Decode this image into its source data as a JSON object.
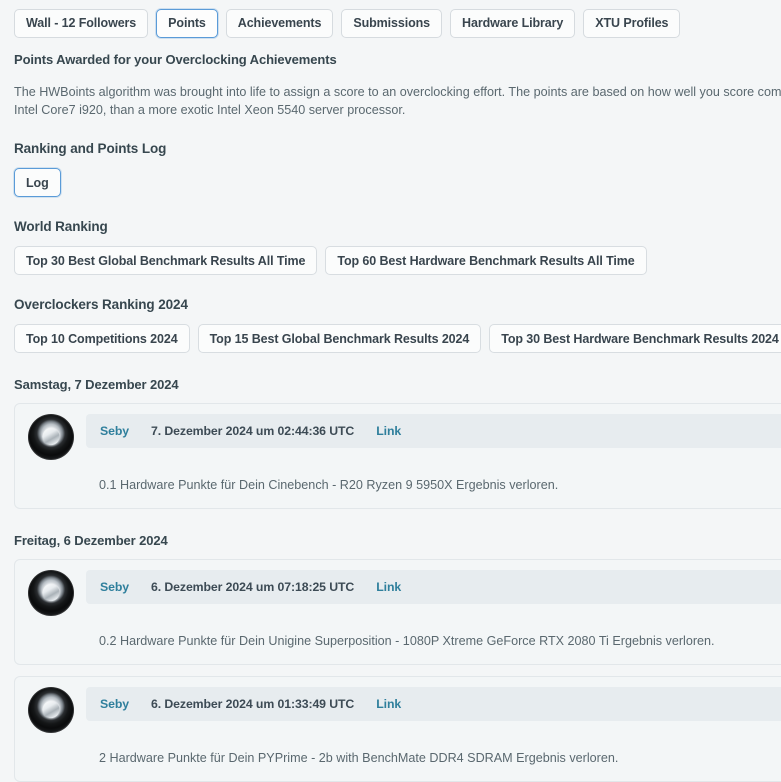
{
  "tabs": [
    {
      "label": "Wall - 12 Followers",
      "active": false
    },
    {
      "label": "Points",
      "active": true
    },
    {
      "label": "Achievements",
      "active": false
    },
    {
      "label": "Submissions",
      "active": false
    },
    {
      "label": "Hardware Library",
      "active": false
    },
    {
      "label": "XTU Profiles",
      "active": false
    }
  ],
  "page": {
    "heading": "Points Awarded for your Overclocking Achievements",
    "intro": "The HWBoints algorithm was brought into life to assign a score to an overclocking effort. The points are based on how well you score compared to others. You will get more points for being first with a popular Intel Core7 i920, than a more exotic Intel Xeon 5540 server processor."
  },
  "ranking_log": {
    "title": "Ranking and Points Log",
    "buttons": [
      {
        "label": "Log",
        "focused": true
      }
    ]
  },
  "world_ranking": {
    "title": "World Ranking",
    "buttons": [
      {
        "label": "Top 30 Best Global Benchmark Results All Time",
        "focused": false
      },
      {
        "label": "Top 60 Best Hardware Benchmark Results All Time",
        "focused": false
      }
    ]
  },
  "overclockers_ranking": {
    "title": "Overclockers Ranking 2024",
    "buttons": [
      {
        "label": "Top 10 Competitions 2024",
        "focused": false
      },
      {
        "label": "Top 15 Best Global Benchmark Results 2024",
        "focused": false
      },
      {
        "label": "Top 30 Best Hardware Benchmark Results 2024",
        "focused": false
      }
    ]
  },
  "log_days": [
    {
      "date_heading": "Samstag, 7 Dezember 2024",
      "entries": [
        {
          "author": "Seby",
          "timestamp": "7. Dezember 2024 um 02:44:36 UTC",
          "link_label": "Link",
          "message": "0.1 Hardware Punkte für Dein Cinebench - R20 Ryzen 9 5950X Ergebnis verloren.",
          "avatar_icon": "user-avatar-icon"
        }
      ]
    },
    {
      "date_heading": "Freitag, 6 Dezember 2024",
      "entries": [
        {
          "author": "Seby",
          "timestamp": "6. Dezember 2024 um 07:18:25 UTC",
          "link_label": "Link",
          "message": "0.2 Hardware Punkte für Dein Unigine Superposition - 1080P Xtreme GeForce RTX 2080 Ti Ergebnis verloren.",
          "avatar_icon": "user-avatar-icon"
        },
        {
          "author": "Seby",
          "timestamp": "6. Dezember 2024 um 01:33:49 UTC",
          "link_label": "Link",
          "message": "2 Hardware Punkte für Dein PYPrime - 2b with BenchMate DDR4 SDRAM Ergebnis verloren.",
          "avatar_icon": "user-avatar-icon"
        }
      ]
    }
  ],
  "colors": {
    "page_background": "#f4f6f7",
    "heading_text": "#37474f",
    "body_text": "#5a686f",
    "link": "#2f7f9c",
    "focus_border": "#5a9bd8",
    "card_background": "#f3f6f7",
    "entry_header_background": "#e7ecef"
  }
}
